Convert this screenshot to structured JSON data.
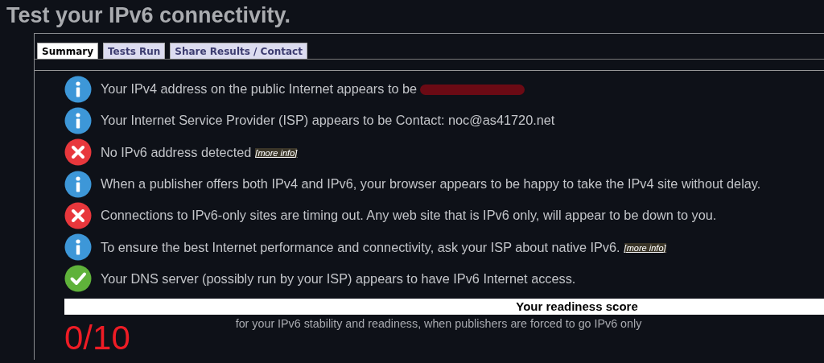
{
  "title": "Test your IPv6 connectivity.",
  "tabs": [
    {
      "label": "Summary",
      "selected": true
    },
    {
      "label": "Tests Run",
      "selected": false
    },
    {
      "label": "Share Results / Contact",
      "selected": false
    }
  ],
  "messages": [
    {
      "kind": "info",
      "text": "Your IPv4 address on the public Internet appears to be",
      "redacted": true
    },
    {
      "kind": "info",
      "text": "Your Internet Service Provider (ISP) appears to be Contact: noc@as41720.net"
    },
    {
      "kind": "error",
      "text": "No IPv6 address detected",
      "link": "[more info]"
    },
    {
      "kind": "info",
      "text": "When a publisher offers both IPv4 and IPv6, your browser appears to be happy to take the IPv4 site without delay."
    },
    {
      "kind": "error",
      "text": "Connections to IPv6-only sites are timing out. Any web site that is IPv6 only, will appear to be down to you."
    },
    {
      "kind": "info",
      "text": "To ensure the best Internet performance and connectivity, ask your ISP about native IPv6.",
      "link": "[more info]"
    },
    {
      "kind": "ok",
      "text": "Your DNS server (possibly run by your ISP) appears to have IPv6 Internet access."
    }
  ],
  "score": {
    "heading": "Your readiness score",
    "caption": "for your IPv6 stability and readiness, when publishers are forced to go IPv6 only",
    "value": "0/10"
  }
}
